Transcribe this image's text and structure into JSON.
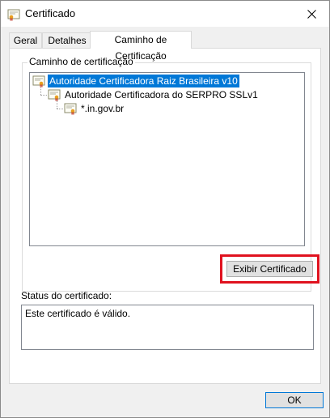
{
  "window": {
    "title": "Certificado",
    "icon": "certificate-icon",
    "close_icon": "close-icon"
  },
  "tabs": [
    {
      "label": "Geral"
    },
    {
      "label": "Detalhes"
    },
    {
      "label": "Caminho de Certificação",
      "active": true
    }
  ],
  "path_group": {
    "label": "Caminho de certificação",
    "tree": [
      {
        "label": "Autoridade Certificadora Raiz Brasileira v10",
        "level": 0,
        "selected": true
      },
      {
        "label": "Autoridade Certificadora do SERPRO SSLv1",
        "level": 1
      },
      {
        "label": "*.in.gov.br",
        "level": 2
      }
    ],
    "view_button_label": "Exibir Certificado"
  },
  "status": {
    "label": "Status do certificado:",
    "text": "Este certificado é válido."
  },
  "ok_button_label": "OK",
  "colors": {
    "selection": "#0078d7",
    "highlight_border": "#e0121f",
    "dialog_bg": "#f0f0f0"
  }
}
